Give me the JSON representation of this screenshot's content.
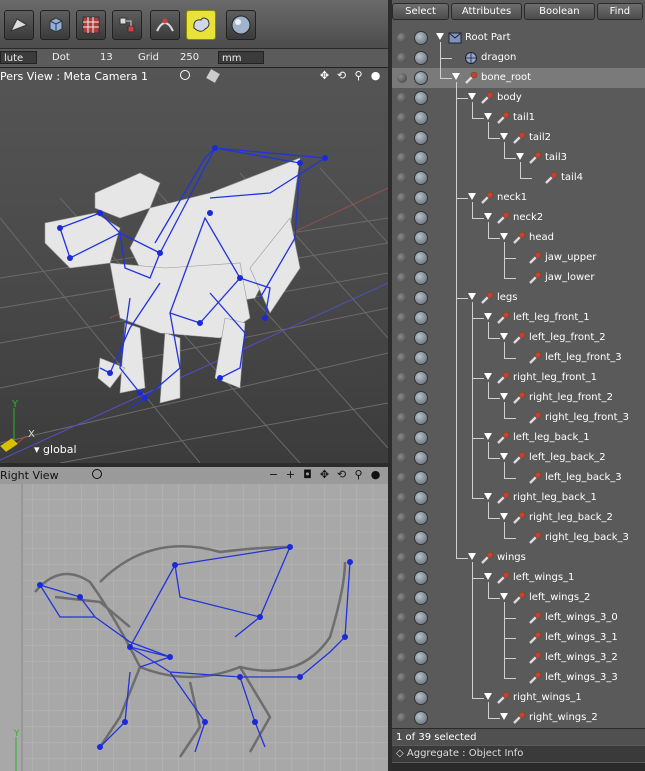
{
  "toolbar": {
    "buttons": [
      {
        "name": "edit-tool-icon"
      },
      {
        "name": "box-primitive-icon"
      },
      {
        "name": "grid-tool-icon"
      },
      {
        "name": "node-tool-icon"
      },
      {
        "name": "bend-tool-icon"
      },
      {
        "name": "sculpt-tool-icon",
        "active": true
      },
      {
        "name": "sphere-material-icon"
      }
    ]
  },
  "options": {
    "mode_value": "lute",
    "dot_label": "Dot",
    "dot_value": "13",
    "grid_label": "Grid",
    "grid_value": "250",
    "unit_value": "mm"
  },
  "pers_view": {
    "title": "Pers View : Meta Camera 1",
    "axis_y": "Y",
    "axis_x": "X",
    "coord_label": "global"
  },
  "right_view": {
    "title": "Right View",
    "axis_y": "Y"
  },
  "browser": {
    "tabs": [
      "Select",
      "Attributes",
      "Boolean",
      "Find"
    ],
    "tree": [
      {
        "label": "Root Part",
        "depth": 0,
        "type": "part",
        "expanded": true
      },
      {
        "label": "dragon",
        "depth": 1,
        "type": "mesh"
      },
      {
        "label": "bone_root",
        "depth": 1,
        "type": "bone",
        "expanded": true
      },
      {
        "label": "body",
        "depth": 2,
        "type": "bone",
        "expanded": true
      },
      {
        "label": "tail1",
        "depth": 3,
        "type": "bone",
        "expanded": true
      },
      {
        "label": "tail2",
        "depth": 4,
        "type": "bone",
        "expanded": true
      },
      {
        "label": "tail3",
        "depth": 5,
        "type": "bone",
        "expanded": true
      },
      {
        "label": "tail4",
        "depth": 6,
        "type": "bone"
      },
      {
        "label": "neck1",
        "depth": 2,
        "type": "bone",
        "expanded": true
      },
      {
        "label": "neck2",
        "depth": 3,
        "type": "bone",
        "expanded": true
      },
      {
        "label": "head",
        "depth": 4,
        "type": "bone",
        "expanded": true
      },
      {
        "label": "jaw_upper",
        "depth": 5,
        "type": "bone"
      },
      {
        "label": "jaw_lower",
        "depth": 5,
        "type": "bone"
      },
      {
        "label": "legs",
        "depth": 2,
        "type": "bone",
        "expanded": true
      },
      {
        "label": "left_leg_front_1",
        "depth": 3,
        "type": "bone",
        "expanded": true
      },
      {
        "label": "left_leg_front_2",
        "depth": 4,
        "type": "bone",
        "expanded": true
      },
      {
        "label": "left_leg_front_3",
        "depth": 5,
        "type": "bone"
      },
      {
        "label": "right_leg_front_1",
        "depth": 3,
        "type": "bone",
        "expanded": true
      },
      {
        "label": "right_leg_front_2",
        "depth": 4,
        "type": "bone",
        "expanded": true
      },
      {
        "label": "right_leg_front_3",
        "depth": 5,
        "type": "bone"
      },
      {
        "label": "left_leg_back_1",
        "depth": 3,
        "type": "bone",
        "expanded": true
      },
      {
        "label": "left_leg_back_2",
        "depth": 4,
        "type": "bone",
        "expanded": true
      },
      {
        "label": "left_leg_back_3",
        "depth": 5,
        "type": "bone"
      },
      {
        "label": "right_leg_back_1",
        "depth": 3,
        "type": "bone",
        "expanded": true
      },
      {
        "label": "right_leg_back_2",
        "depth": 4,
        "type": "bone",
        "expanded": true
      },
      {
        "label": "right_leg_back_3",
        "depth": 5,
        "type": "bone"
      },
      {
        "label": "wings",
        "depth": 2,
        "type": "bone",
        "expanded": true
      },
      {
        "label": "left_wings_1",
        "depth": 3,
        "type": "bone",
        "expanded": true
      },
      {
        "label": "left_wings_2",
        "depth": 4,
        "type": "bone",
        "expanded": true
      },
      {
        "label": "left_wings_3_0",
        "depth": 5,
        "type": "bone"
      },
      {
        "label": "left_wings_3_1",
        "depth": 5,
        "type": "bone"
      },
      {
        "label": "left_wings_3_2",
        "depth": 5,
        "type": "bone"
      },
      {
        "label": "left_wings_3_3",
        "depth": 5,
        "type": "bone"
      },
      {
        "label": "right_wings_1",
        "depth": 3,
        "type": "bone",
        "expanded": true
      },
      {
        "label": "right_wings_2",
        "depth": 4,
        "type": "bone",
        "expanded": true
      }
    ],
    "status": "1 of 39 selected",
    "info": "Aggregate : Object Info"
  }
}
